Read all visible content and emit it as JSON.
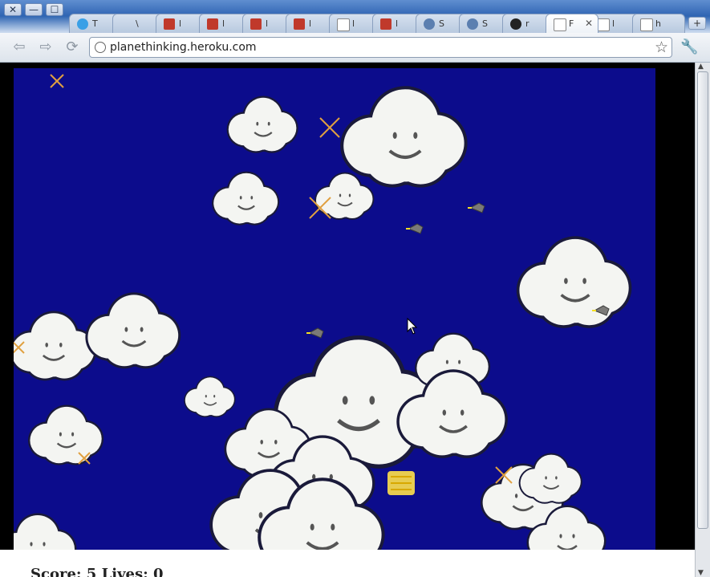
{
  "window": {
    "controls": {
      "close": "✕",
      "minimize": "—",
      "maximize": "☐"
    }
  },
  "tabs": [
    {
      "favicon": "twitter-bird-icon",
      "favicon_color": "#3aa0e6",
      "title": "T",
      "active": false
    },
    {
      "favicon": "none",
      "favicon_color": "",
      "title": "\\",
      "active": false
    },
    {
      "favicon": "gs-logo-icon",
      "favicon_color": "#c0392b",
      "title": "l",
      "active": false
    },
    {
      "favicon": "gs-logo-icon",
      "favicon_color": "#c0392b",
      "title": "l",
      "active": false
    },
    {
      "favicon": "gs-logo-icon",
      "favicon_color": "#c0392b",
      "title": "l",
      "active": false
    },
    {
      "favicon": "ld48-logo-icon",
      "favicon_color": "#c0392b",
      "title": "l",
      "active": false
    },
    {
      "favicon": "page-icon",
      "favicon_color": "#ffffff",
      "title": "l",
      "active": false
    },
    {
      "favicon": "ld48-logo-icon",
      "favicon_color": "#c0392b",
      "title": "l",
      "active": false
    },
    {
      "favicon": "globe-icon",
      "favicon_color": "#5b7fb0",
      "title": "S",
      "active": false
    },
    {
      "favicon": "globe-icon",
      "favicon_color": "#5b7fb0",
      "title": "S",
      "active": false
    },
    {
      "favicon": "github-icon",
      "favicon_color": "#222222",
      "title": "r",
      "active": false
    },
    {
      "favicon": "page-icon",
      "favicon_color": "#ffffff",
      "title": "F",
      "active": true
    },
    {
      "favicon": "page-icon",
      "favicon_color": "#ffffff",
      "title": "l",
      "active": false
    },
    {
      "favicon": "page-icon",
      "favicon_color": "#ffffff",
      "title": "h",
      "active": false
    }
  ],
  "toolbar": {
    "back_icon": "back-arrow-icon",
    "forward_icon": "forward-arrow-icon",
    "reload_icon": "reload-icon",
    "url": "planethinking.heroku.com",
    "bookmark_icon": "star-icon",
    "menu_icon": "wrench-icon"
  },
  "game": {
    "background_color": "#0c0c8c",
    "status_text": "Score: 5   Lives: 0",
    "clouds": 22,
    "planes": 4,
    "sparkles": 7,
    "bonus_sprite_color": "#ffe14a"
  }
}
